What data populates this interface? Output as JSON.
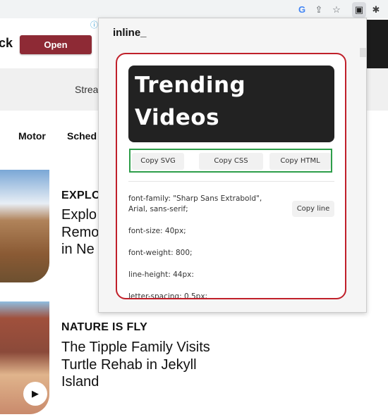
{
  "browser": {
    "icons": [
      "google-icon",
      "share-icon",
      "star-icon",
      "inline-extension-icon",
      "puzzle-icon"
    ],
    "glyphs": [
      "G",
      "⇪",
      "☆",
      "▣",
      "✱"
    ]
  },
  "ad": {
    "text": "ck",
    "button": "Open",
    "button_color": "#8e2a35",
    "info": "ⓘ"
  },
  "band": {
    "text": "Strea"
  },
  "nav": {
    "items": [
      "Motor",
      "Sched"
    ]
  },
  "articles": [
    {
      "kicker": "EXPLO",
      "title_lines": [
        "Explo",
        "Remo",
        "in Ne"
      ]
    },
    {
      "kicker": "NATURE IS FLY",
      "title_lines": [
        "The Tipple Family Visits",
        "Turtle Rehab in Jekyll",
        "Island"
      ]
    }
  ],
  "popup": {
    "logo": "inline_",
    "preview": {
      "line1": "Trending",
      "line2": "Videos"
    },
    "buttons": {
      "svg": "Copy SVG",
      "css": "Copy CSS",
      "html": "Copy HTML"
    },
    "css_lines": [
      "font-family: \"Sharp Sans Extrabold\",",
      "Arial, sans-serif;",
      "font-size: 40px;",
      "font-weight: 800;",
      "line-height: 44px:",
      "letter-spacing: 0.5px;"
    ],
    "copy_line": "Copy line",
    "colors": {
      "highlight_red": "#c0202a",
      "highlight_green": "#2e9e4a"
    }
  }
}
